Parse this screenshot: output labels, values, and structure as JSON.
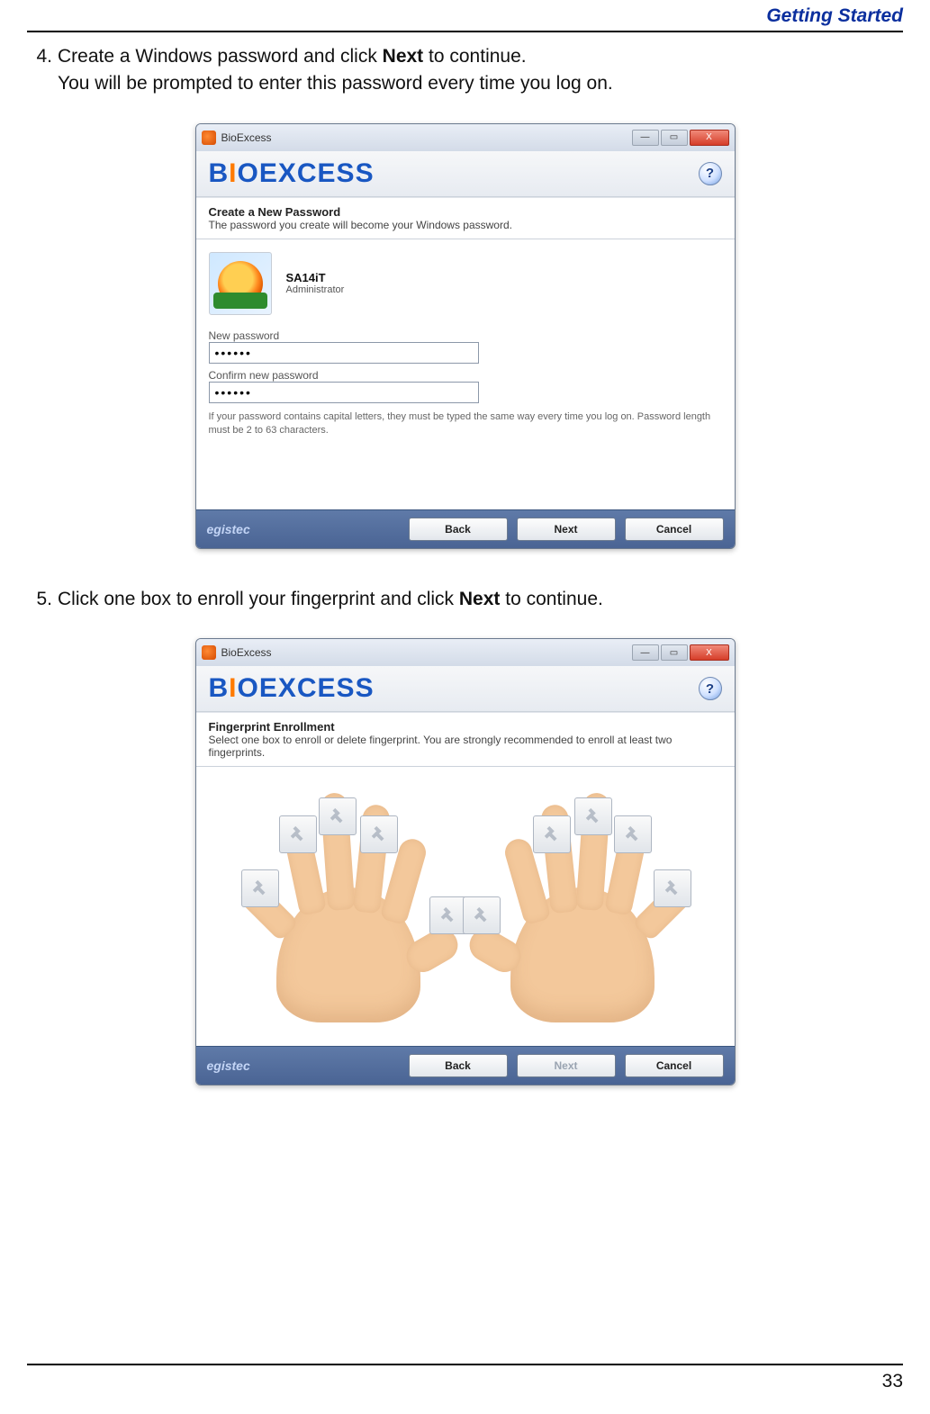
{
  "header": {
    "title": "Getting Started"
  },
  "steps": {
    "s4": {
      "num": "4.",
      "l1a": "Create a Windows password and click ",
      "l1b": "Next",
      "l1c": " to continue.",
      "l2": "You will be prompted to enter this password every time you log on."
    },
    "s5": {
      "num": "5.",
      "l1a": "Click one box to enroll your fingerprint and click ",
      "l1b": "Next",
      "l1c": " to continue."
    }
  },
  "window": {
    "title": "BioExcess",
    "logo": {
      "b": "B",
      "i": "I",
      "o": "O",
      "rest": "EXCESS"
    },
    "help": "?",
    "brand_footer": "egistec",
    "buttons": {
      "back": "Back",
      "next": "Next",
      "cancel": "Cancel"
    },
    "winbtns": {
      "min": "—",
      "max": "▭",
      "close": "X"
    }
  },
  "dialog1": {
    "title": "Create a New Password",
    "subtitle": "The password you create will become your Windows password.",
    "user_name": "SA14iT",
    "user_role": "Administrator",
    "label_new": "New password",
    "value_new": "••••••",
    "label_confirm": "Confirm new password",
    "value_confirm": "••••••",
    "hint": "If your password contains capital letters, they must be typed the same way every time you log on. Password length must be 2 to 63 characters."
  },
  "dialog2": {
    "title": "Fingerprint Enrollment",
    "subtitle": "Select one box to enroll or delete fingerprint. You are strongly recommended to enroll at least two fingerprints."
  },
  "page_number": "33"
}
